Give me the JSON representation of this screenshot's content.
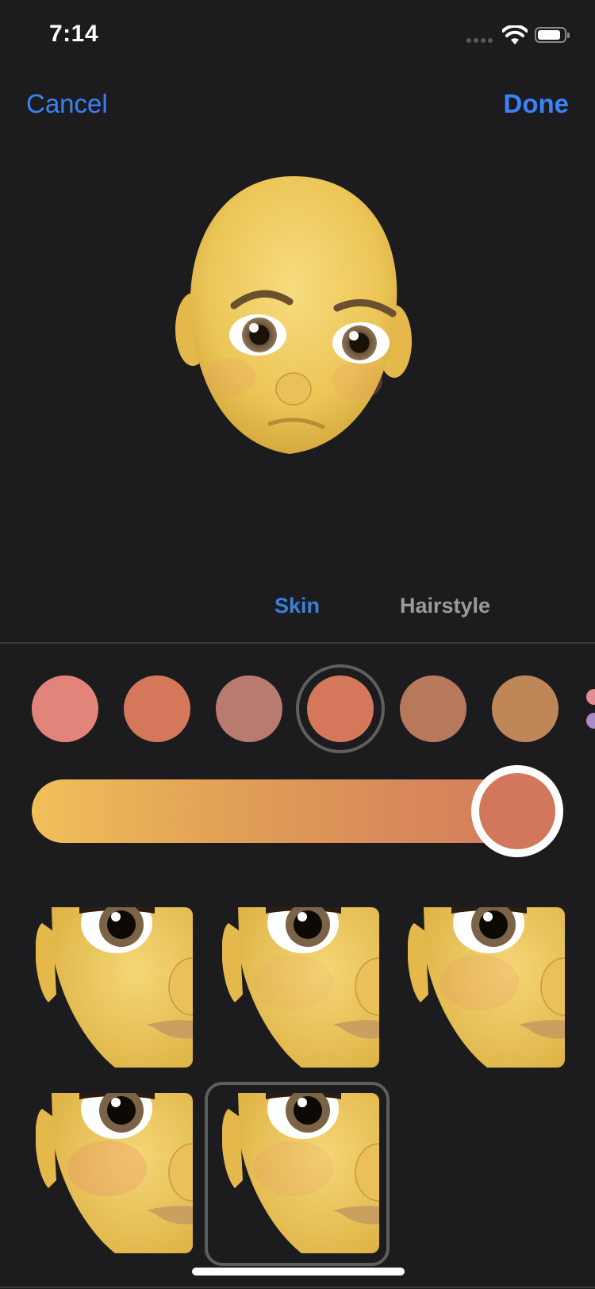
{
  "status_bar": {
    "time": "7:14",
    "signal_icon": "cellular-signal-icon",
    "wifi_icon": "wifi-icon",
    "battery_icon": "battery-icon"
  },
  "nav": {
    "cancel_label": "Cancel",
    "done_label": "Done",
    "accent_color": "#3b82f6"
  },
  "avatar_preview": {
    "description": "Memoji head preview, bald, yellow skin, brown eyes"
  },
  "tabs": [
    {
      "label": "Skin",
      "selected": true
    },
    {
      "label": "Hairstyle",
      "selected": false
    }
  ],
  "skin_colors": {
    "swatches": [
      "#e3847a",
      "#d5775a",
      "#b97a70",
      "#d4775a",
      "#b7785c",
      "#bf8658"
    ],
    "selected_index": 3,
    "more_swatches_peek": [
      "#e58b93",
      "#a98bc9"
    ]
  },
  "skin_tone_slider": {
    "value_fraction": 0.95,
    "thumb_color": "#d2775b",
    "gradient": [
      "#f0c05a",
      "#d2785c"
    ]
  },
  "face_options": {
    "count": 5,
    "selected_index": 4
  }
}
